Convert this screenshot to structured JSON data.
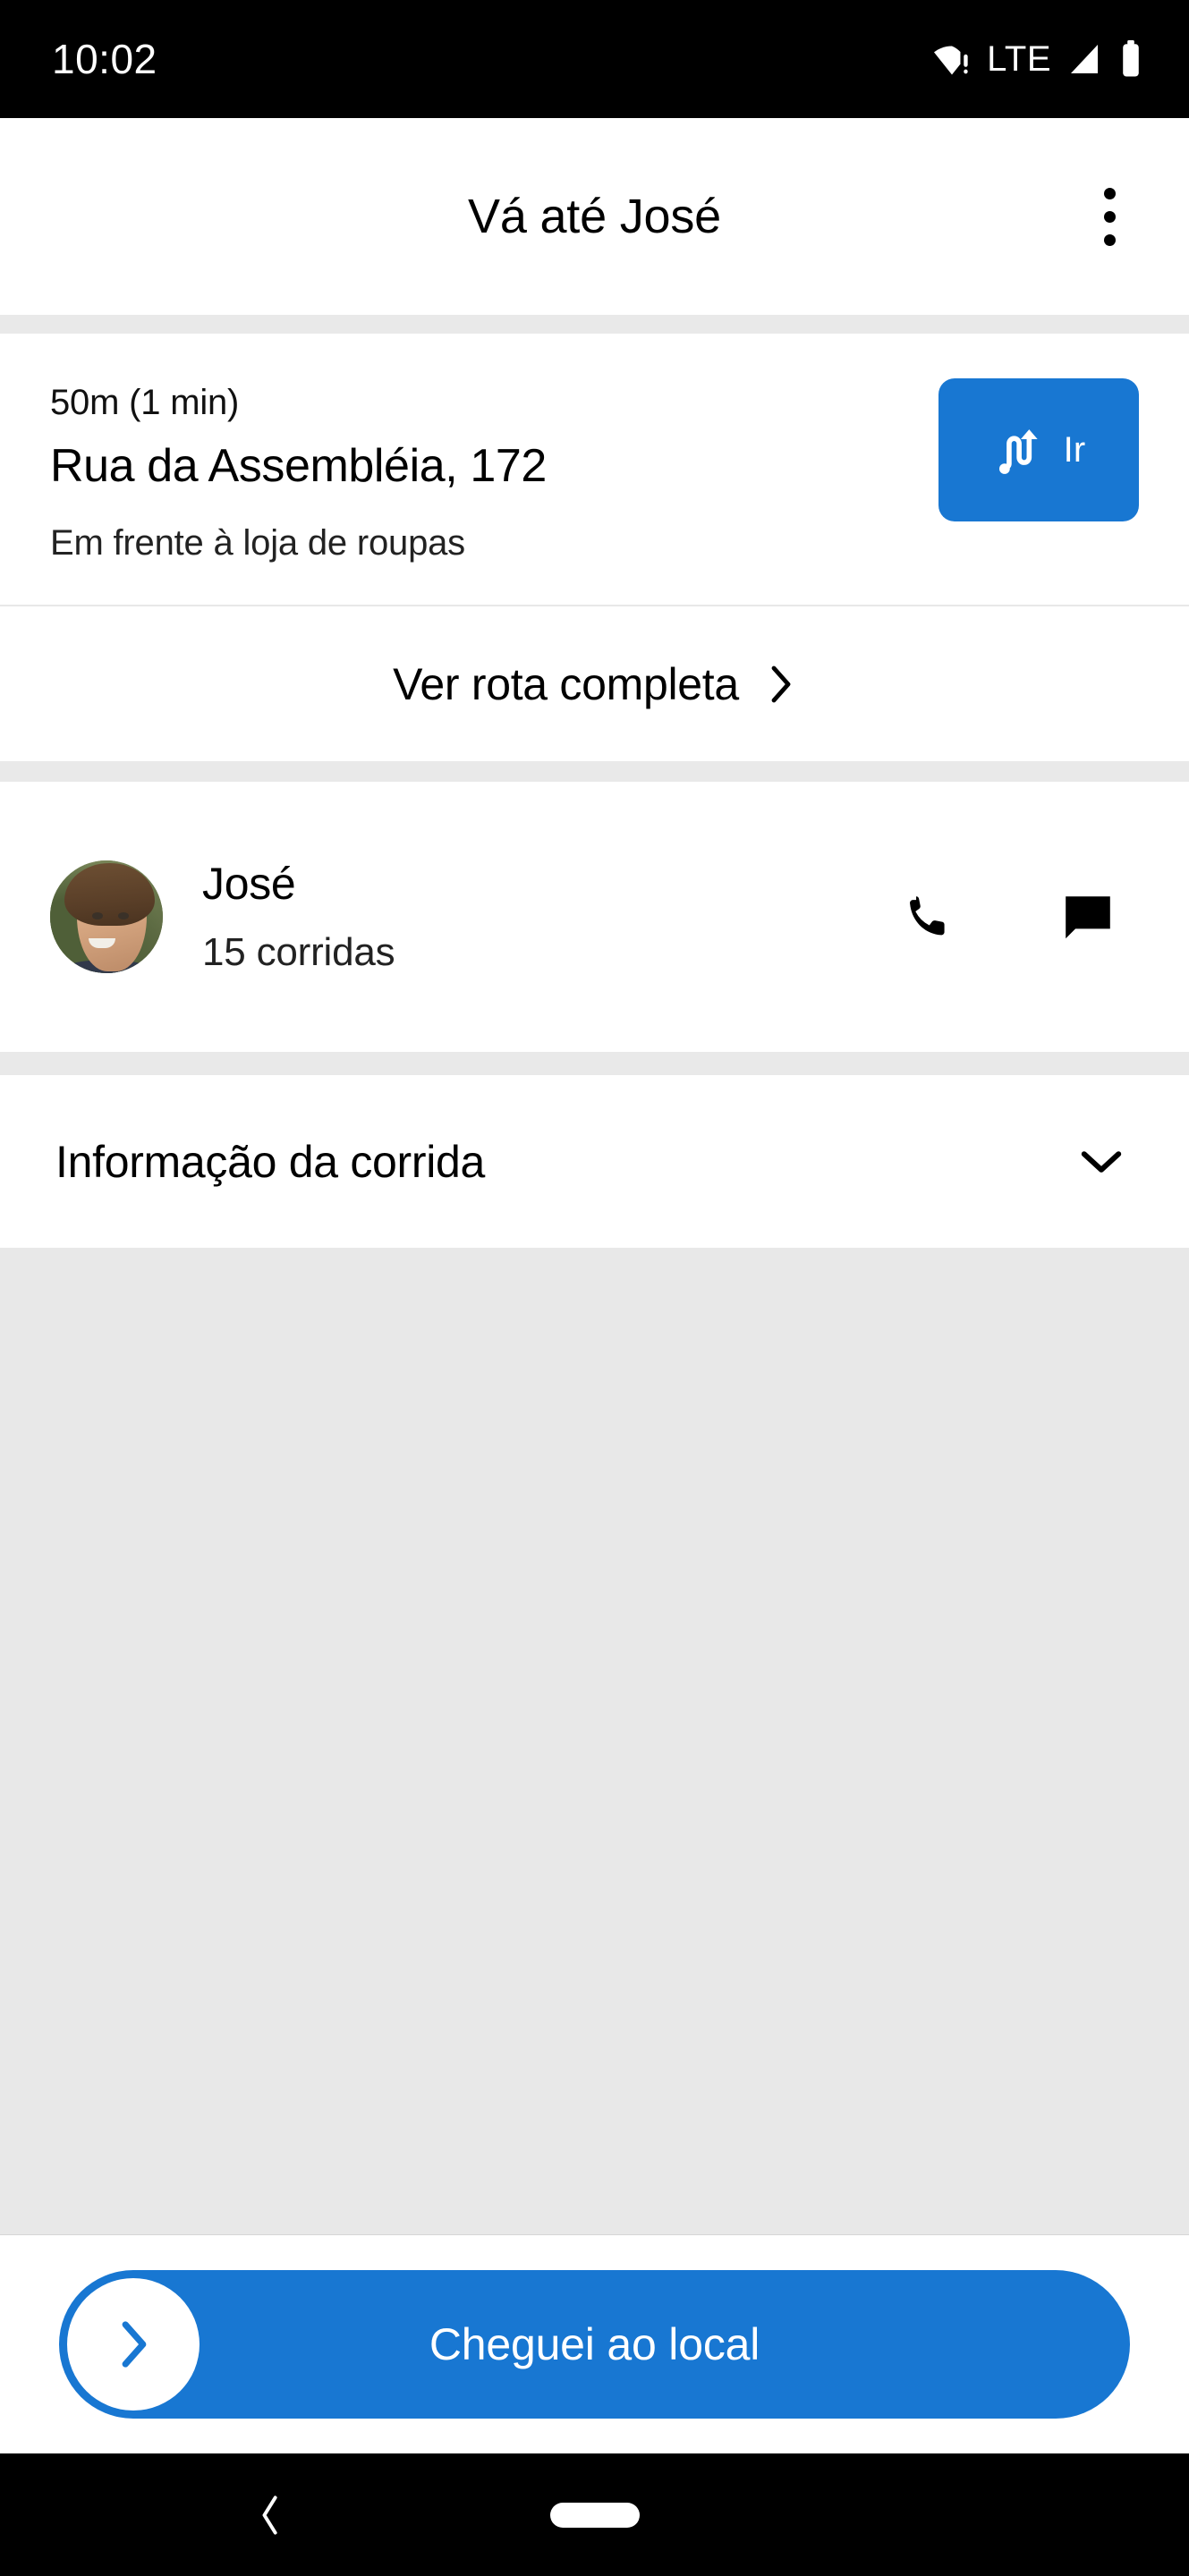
{
  "status_bar": {
    "time": "10:02",
    "network_label": "LTE",
    "icons": [
      "wifi-warning-icon",
      "signal-icon",
      "battery-icon"
    ]
  },
  "app_bar": {
    "title": "Vá até José",
    "overflow_icon": "more-vertical-icon"
  },
  "destination": {
    "eta": "50m (1 min)",
    "street": "Rua da Assembléia, 172",
    "note": "Em frente à loja de roupas",
    "go_button": {
      "label": "Ir",
      "icon": "route-navigate-icon",
      "color": "#1877d2"
    }
  },
  "full_route": {
    "label": "Ver rota completa",
    "chevron_icon": "chevron-right-icon"
  },
  "passenger": {
    "avatar_icon": "passenger-avatar-photo",
    "name": "José",
    "rides": "15 corridas",
    "call_icon": "phone-icon",
    "chat_icon": "chat-bubble-icon"
  },
  "ride_info": {
    "label": "Informação da corrida",
    "chevron_icon": "chevron-down-icon",
    "expanded": false
  },
  "map": {
    "placeholder_color": "#e8e8e8"
  },
  "cta": {
    "label": "Cheguei ao local",
    "knob_icon": "chevron-right-icon",
    "color": "#1877d2"
  },
  "nav_bar": {
    "back_icon": "back-chevron-icon",
    "home_icon": "home-pill-icon"
  }
}
